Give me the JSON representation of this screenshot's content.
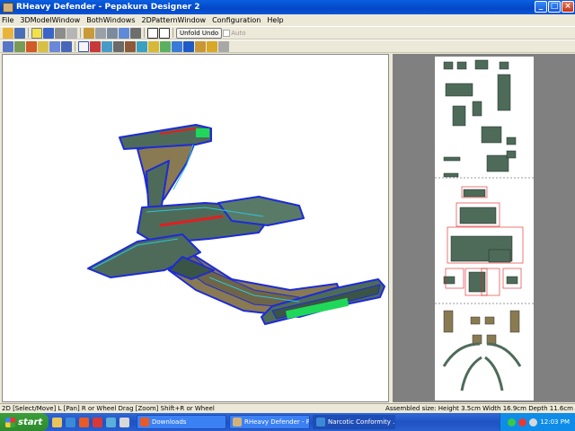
{
  "window": {
    "title": "RHeavy Defender - Pepakura Designer 2"
  },
  "menu": [
    "File",
    "3DModelWindow",
    "BothWindows",
    "2DPatternWindow",
    "Configuration",
    "Help"
  ],
  "toolbar": {
    "unfold_undo": "Unfold Undo",
    "auto": "Auto"
  },
  "status": {
    "left": "2D [Select/Move] L [Pan] R or Wheel Drag [Zoom] Shift+R or Wheel",
    "right": "Assembled size: Height 3.5cm Width 16.9cm Depth 11.6cm"
  },
  "taskbar": {
    "start": "start",
    "tasks": [
      "Downloads",
      "RHeavy Defender - P...",
      "Narcotic Conformity ..."
    ],
    "clock": "12:03 PM"
  },
  "colors": {
    "hull": "#4e6b5a",
    "deck": "#8a7a52",
    "edge": "#1d2bd8",
    "glow": "#1fd85a",
    "red": "#e21f1f"
  }
}
